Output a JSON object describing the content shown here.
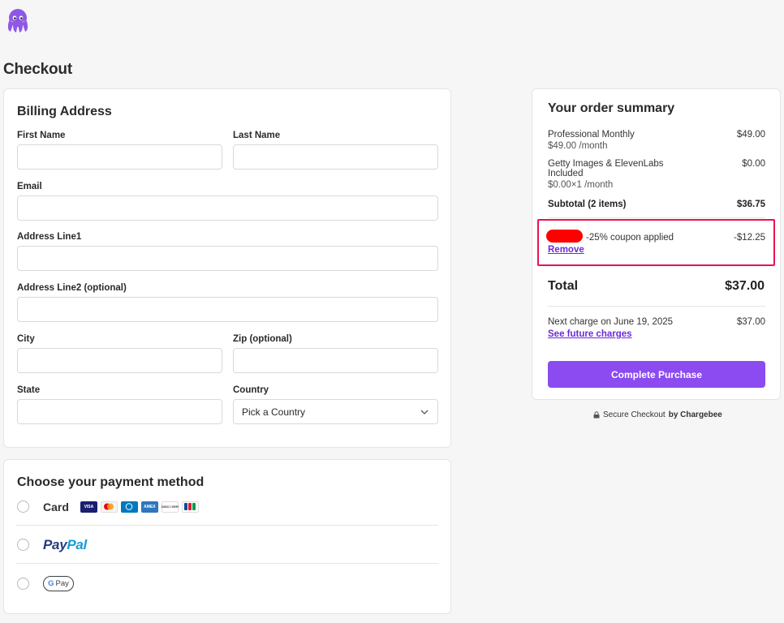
{
  "page": {
    "title": "Checkout"
  },
  "billing": {
    "title": "Billing Address",
    "fields": {
      "first_name": {
        "label": "First Name",
        "value": ""
      },
      "last_name": {
        "label": "Last Name",
        "value": ""
      },
      "email": {
        "label": "Email",
        "value": ""
      },
      "address1": {
        "label": "Address Line1",
        "value": ""
      },
      "address2": {
        "label": "Address Line2 (optional)",
        "value": ""
      },
      "city": {
        "label": "City",
        "value": ""
      },
      "zip": {
        "label": "Zip (optional)",
        "value": ""
      },
      "state": {
        "label": "State",
        "value": ""
      },
      "country": {
        "label": "Country",
        "selected": "Pick a Country"
      }
    }
  },
  "payment": {
    "title": "Choose your payment method",
    "methods": [
      {
        "label": "Card",
        "brands": [
          "VISA",
          "MC",
          "DINERS",
          "AMEX",
          "DISCOVER",
          "JCB"
        ]
      },
      {
        "label_part1": "Pay",
        "label_part2": "Pal"
      },
      {
        "label_g": "G",
        "label_pay": "Pay"
      }
    ],
    "brand_colors": {
      "visa": "#1a1f71",
      "mc": "#eb001b",
      "diners": "#0079be",
      "amex": "#2e77bc",
      "discover": "#ff6000",
      "jcb": "#0e4c96"
    }
  },
  "summary": {
    "title": "Your order summary",
    "items": [
      {
        "name": "Professional Monthly",
        "sub": "$49.00 /month",
        "price": "$49.00"
      },
      {
        "name": "Getty Images & ElevenLabs",
        "name2": "Included",
        "sub": "$0.00×1 /month",
        "price": "$0.00"
      }
    ],
    "subtotal_label": "Subtotal (2 items)",
    "subtotal_value": "$36.75",
    "coupon_text": "-25% coupon applied",
    "coupon_value": "-$12.25",
    "remove_label": "Remove",
    "total_label": "Total",
    "total_value": "$37.00",
    "next_charge_label": "Next charge on June 19, 2025",
    "next_charge_value": "$37.00",
    "future_link": "See future charges",
    "cta_label": "Complete Purchase"
  },
  "footer": {
    "secure_text": "Secure Checkout",
    "by_text": "by Chargebee"
  },
  "colors": {
    "accent": "#8b4bf0",
    "link": "#6b2bd9",
    "highlight": "#e8144f"
  }
}
